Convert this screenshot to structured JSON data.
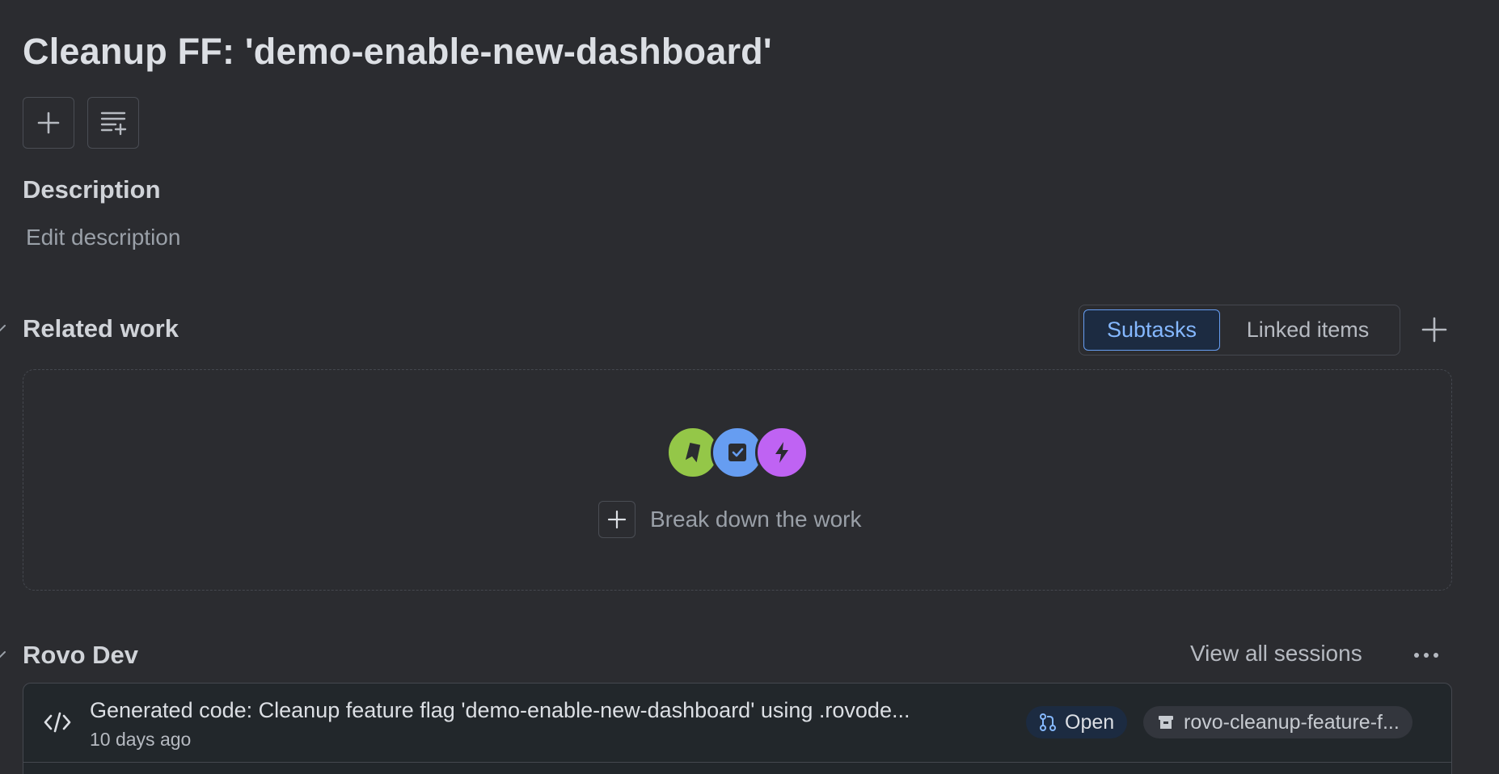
{
  "issue": {
    "title": "Cleanup FF: 'demo-enable-new-dashboard'"
  },
  "toolbar": {
    "add_icon": "plus-icon",
    "create_subtasks_icon": "list-add-icon"
  },
  "description": {
    "heading": "Description",
    "placeholder": "Edit description"
  },
  "related_work": {
    "heading": "Related work",
    "tabs": [
      {
        "label": "Subtasks",
        "active": true
      },
      {
        "label": "Linked items",
        "active": false
      }
    ],
    "empty_icons": [
      "story-icon",
      "task-icon",
      "epic-icon"
    ],
    "empty_action": "Break down the work"
  },
  "rovo_dev": {
    "heading": "Rovo Dev",
    "view_all": "View all sessions",
    "sessions": [
      {
        "title": "Generated code: Cleanup feature flag 'demo-enable-new-dashboard' using .rovode...",
        "time": "10 days ago",
        "status": "Open",
        "branch": "rovo-cleanup-feature-f..."
      }
    ]
  },
  "colors": {
    "background": "#2b2c30",
    "accent": "#669df1",
    "story_green": "#94c748",
    "task_blue": "#669df1",
    "epic_purple": "#bf63f3"
  }
}
